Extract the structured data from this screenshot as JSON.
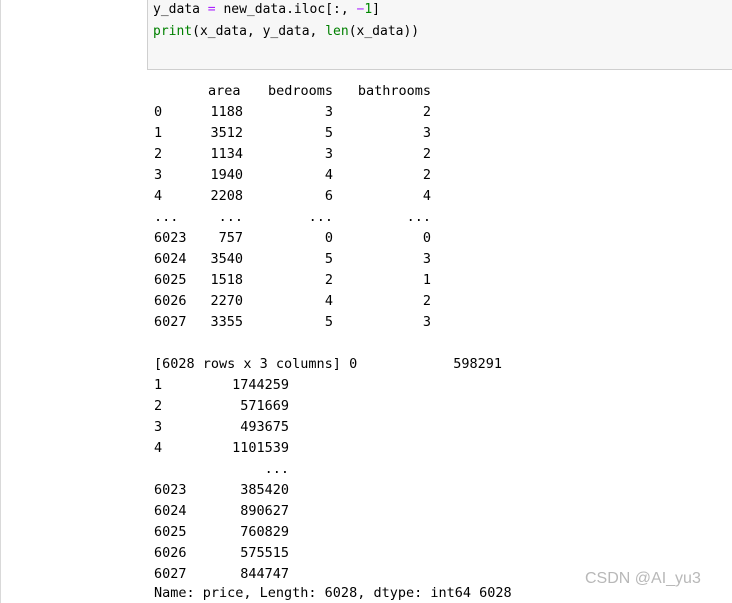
{
  "code": {
    "line1": {
      "prefix": "y_data ",
      "op": "=",
      "mid": " new_data.iloc[:, ",
      "minus": "−",
      "num": "1",
      "suffix": "]"
    },
    "line2": {
      "builtin1": "print",
      "mid1": "(x_data, y_data, ",
      "builtin2": "len",
      "mid2": "(x_data))"
    }
  },
  "dataframe": {
    "columns": [
      "area",
      "bedrooms",
      "bathrooms"
    ],
    "rows": [
      {
        "index": "0",
        "area": "1188",
        "bedrooms": "3",
        "bathrooms": "2"
      },
      {
        "index": "1",
        "area": "3512",
        "bedrooms": "5",
        "bathrooms": "3"
      },
      {
        "index": "2",
        "area": "1134",
        "bedrooms": "3",
        "bathrooms": "2"
      },
      {
        "index": "3",
        "area": "1940",
        "bedrooms": "4",
        "bathrooms": "2"
      },
      {
        "index": "4",
        "area": "2208",
        "bedrooms": "6",
        "bathrooms": "4"
      },
      {
        "index": "...",
        "area": "...",
        "bedrooms": "...",
        "bathrooms": "..."
      },
      {
        "index": "6023",
        "area": "757",
        "bedrooms": "0",
        "bathrooms": "0"
      },
      {
        "index": "6024",
        "area": "3540",
        "bedrooms": "5",
        "bathrooms": "3"
      },
      {
        "index": "6025",
        "area": "1518",
        "bedrooms": "2",
        "bathrooms": "1"
      },
      {
        "index": "6026",
        "area": "2270",
        "bedrooms": "4",
        "bathrooms": "2"
      },
      {
        "index": "6027",
        "area": "3355",
        "bedrooms": "5",
        "bathrooms": "3"
      }
    ],
    "summary": "[6028 rows x 3 columns] 0",
    "first_value": "598291"
  },
  "series": {
    "rows": [
      {
        "index": "1",
        "value": "1744259"
      },
      {
        "index": "2",
        "value": "571669"
      },
      {
        "index": "3",
        "value": "493675"
      },
      {
        "index": "4",
        "value": "1101539"
      },
      {
        "index": "",
        "value": "..."
      },
      {
        "index": "6023",
        "value": "385420"
      },
      {
        "index": "6024",
        "value": "890627"
      },
      {
        "index": "6025",
        "value": "760829"
      },
      {
        "index": "6026",
        "value": "575515"
      },
      {
        "index": "6027",
        "value": "844747"
      }
    ],
    "footer": "Name: price, Length: 6028, dtype: int64 6028"
  },
  "watermark": "CSDN @AI_yu3"
}
